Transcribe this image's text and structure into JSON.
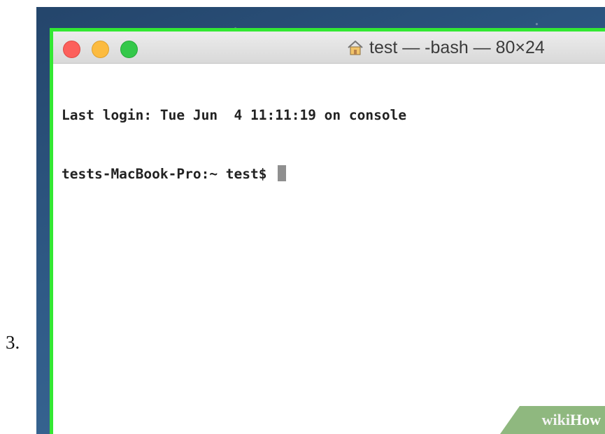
{
  "step_number": "3.",
  "terminal": {
    "title": "test — -bash — 80×24",
    "lines": [
      "Last login: Tue Jun  4 11:11:19 on console",
      "tests-MacBook-Pro:~ test$ "
    ],
    "icons": {
      "title": "home-icon"
    }
  },
  "watermark": {
    "wiki": "wiki",
    "how": "How"
  },
  "colors": {
    "highlight": "#33e833",
    "close": "#fc605c",
    "minimize": "#fcbb40",
    "maximize": "#34c84a"
  }
}
